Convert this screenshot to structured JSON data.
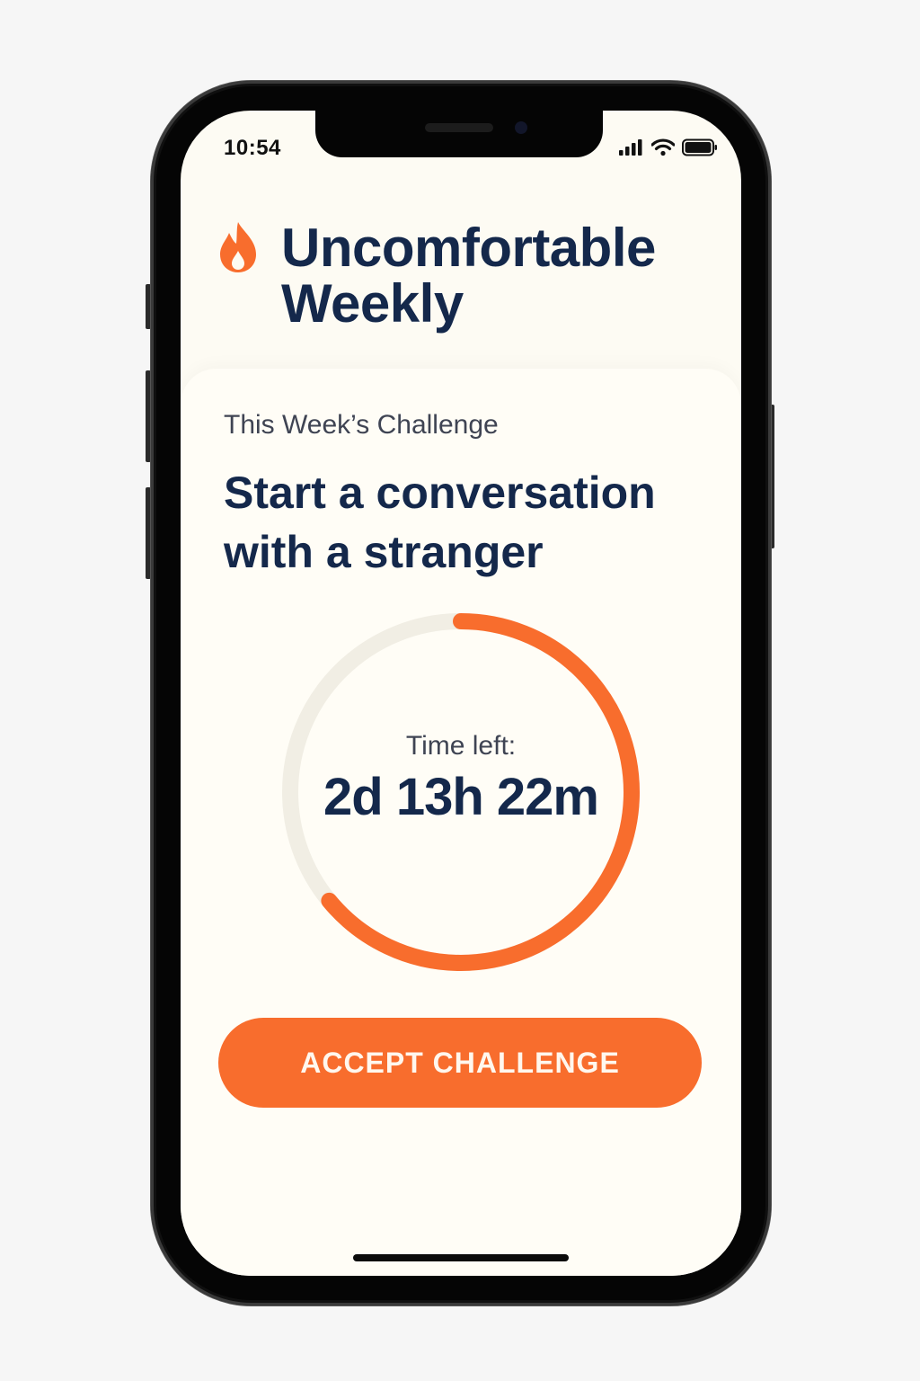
{
  "status_bar": {
    "time": "10:54",
    "icons": [
      "cellular-signal-icon",
      "wifi-icon",
      "battery-icon"
    ]
  },
  "header": {
    "icon": "flame-icon",
    "title": "Uncomfortable Weekly"
  },
  "challenge": {
    "subheading": "This Week’s Challenge",
    "title": "Start a conversation with a stranger"
  },
  "timer": {
    "label": "Time left:",
    "value": "2d 13h 22m",
    "progress_fraction": 0.64
  },
  "actions": {
    "accept_label": "ACCEPT CHALLENGE"
  },
  "colors": {
    "accent": "#f86d2d",
    "title": "#14284b",
    "muted_text": "#3f4453",
    "background": "#fdfbf3",
    "ring_track": "#f1eee4"
  }
}
